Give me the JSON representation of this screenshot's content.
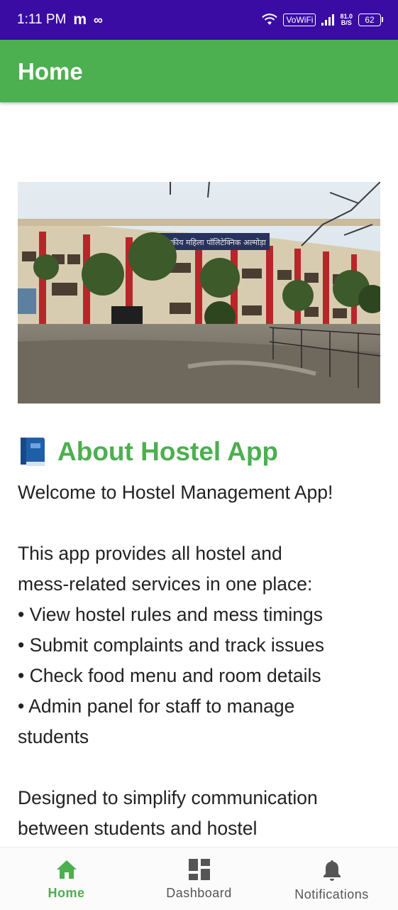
{
  "status_bar": {
    "time": "1:11 PM",
    "app_badge": "m",
    "vowifi": "VoWiFi",
    "speed_value": "81.0",
    "speed_unit": "B/S",
    "battery": "62"
  },
  "app_bar": {
    "title": "Home"
  },
  "about": {
    "title": "About Hostel App",
    "lines": [
      "Welcome to Hostel Management App!",
      "",
      "This app provides all hostel and",
      "mess-related services in one place:",
      "• View hostel rules and mess timings",
      "• Submit complaints and track issues",
      "• Check food menu and room details",
      "• Admin panel for staff to manage",
      "students",
      "",
      "Designed to simplify communication",
      "between students and hostel"
    ]
  },
  "hero_image": {
    "sign_text": "राजकीय महिला पॉलिटेक्निक अल्मोड़ा"
  },
  "bottom_nav": {
    "active_color": "#4caf50",
    "inactive_color": "#555555",
    "items": [
      {
        "label": "Home",
        "icon": "home-icon",
        "active": true
      },
      {
        "label": "Dashboard",
        "icon": "dashboard-icon",
        "active": false
      },
      {
        "label": "Notifications",
        "icon": "bell-icon",
        "active": false
      }
    ]
  }
}
